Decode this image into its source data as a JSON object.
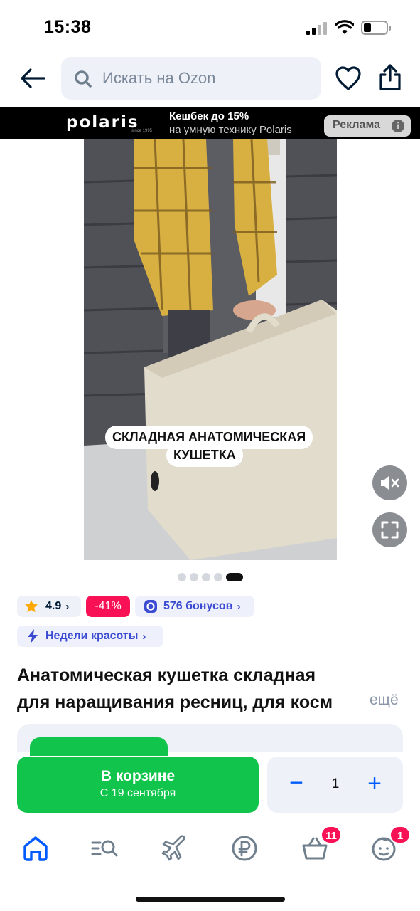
{
  "status_bar": {
    "time": "15:38"
  },
  "search": {
    "placeholder": "Искать на Ozon"
  },
  "ad": {
    "brand": "polaris",
    "brand_tagline": "since 1995",
    "title": "Кешбек до 15%",
    "subtitle": "на умную технику Polaris",
    "badge": "Реклама",
    "info_symbol": "i"
  },
  "media": {
    "caption_line1": "СКЛАДНАЯ АНАТОМИЧЕСКАЯ",
    "caption_line2": "КУШЕТКА",
    "pager_count": 5,
    "pager_active_index": 4
  },
  "chips": {
    "rating": "4.9",
    "discount": "-41%",
    "bonus": "576 бонусов",
    "promo": "Недели красоты"
  },
  "product": {
    "title_line1": "Анатомическая кушетка складная",
    "title_line2": "для наращивания ресниц, для косм",
    "more": "ещё"
  },
  "buy": {
    "cart_label": "В корзине",
    "delivery": "С 19 сентября",
    "quantity": "1",
    "minus": "−",
    "plus": "+"
  },
  "tabbar": {
    "cart_badge": "11",
    "profile_badge": "1"
  },
  "colors": {
    "accent_blue": "#005bff",
    "green": "#10c44c",
    "pink": "#f91155",
    "bonus_blue": "#3b4bd1"
  }
}
